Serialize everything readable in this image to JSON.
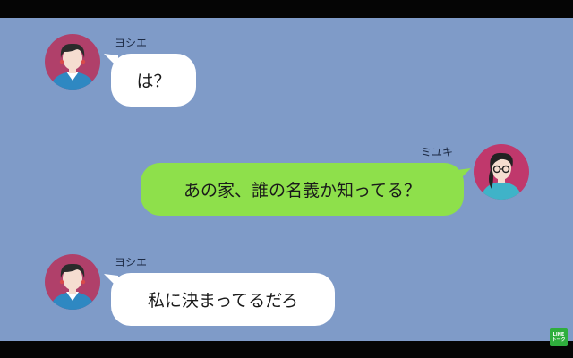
{
  "messages": [
    {
      "sender": "ヨシエ",
      "side": "left",
      "text": "は？"
    },
    {
      "sender": "ミユキ",
      "side": "right",
      "text": "あの家、誰の名義か知ってる？"
    },
    {
      "sender": "ヨシエ",
      "side": "left",
      "text": "私に決まってるだろ"
    }
  ],
  "watermark": {
    "line1": "LINE",
    "line2": "トーク"
  },
  "colors": {
    "background": "#7f9bc8",
    "incoming_bubble": "#ffffff",
    "outgoing_bubble": "#8ee04b",
    "avatar_yoshie_bg": "#b0406a",
    "avatar_miyuki_bg": "#c0386c"
  },
  "icons": {
    "yoshie_avatar": "woman-short-hair-avatar",
    "miyuki_avatar": "woman-glasses-ponytail-avatar",
    "watermark_logo": "line-talk-logo"
  }
}
